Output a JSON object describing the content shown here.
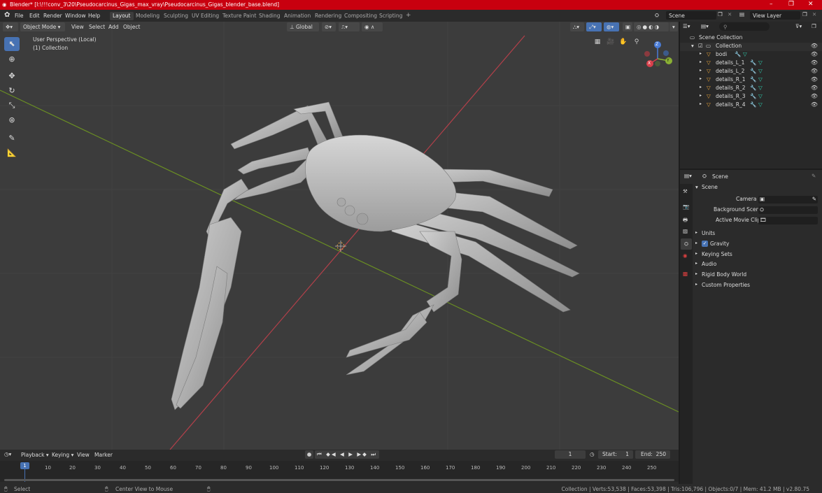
{
  "window": {
    "title": "Blender* [I:\\!!!conv_3\\20\\Pseudocarcinus_Gigas_max_vray\\Pseudocarcinus_Gigas_blender_base.blend]",
    "minimize": "–",
    "maximize": "❐",
    "close": "✕"
  },
  "menu": {
    "items": [
      "File",
      "Edit",
      "Render",
      "Window",
      "Help"
    ]
  },
  "workspaces": [
    "Layout",
    "Modeling",
    "Sculpting",
    "UV Editing",
    "Texture Paint",
    "Shading",
    "Animation",
    "Rendering",
    "Compositing",
    "Scripting",
    "+"
  ],
  "scene_name": "Scene",
  "view_layer": "View Layer",
  "viewport": {
    "mode": "Object Mode",
    "menus": [
      "View",
      "Select",
      "Add",
      "Object"
    ],
    "transform": "Global",
    "overlay_line1": "User Perspective (Local)",
    "overlay_line2": "(1) Collection",
    "gizmo": {
      "z": "Z",
      "y": "Y",
      "x": "X"
    }
  },
  "outliner": {
    "search_placeholder": "",
    "root": "Scene Collection",
    "collection": "Collection",
    "objects": [
      "bodi",
      "details_L_1",
      "details_L_2",
      "details_R_1",
      "details_R_2",
      "details_R_3",
      "details_R_4"
    ]
  },
  "properties": {
    "header": "Scene",
    "panel": "Scene",
    "fields": [
      {
        "label": "Camera",
        "value": ""
      },
      {
        "label": "Background Scene",
        "value": ""
      },
      {
        "label": "Active Movie Clip",
        "value": ""
      }
    ],
    "sections": [
      "Units",
      "Gravity",
      "Keying Sets",
      "Audio",
      "Rigid Body World",
      "Custom Properties"
    ],
    "gravity_checked": true
  },
  "timeline": {
    "menus": [
      "Playback",
      "Keying",
      "View",
      "Marker"
    ],
    "current_frame": "1",
    "start_label": "Start:",
    "start": "1",
    "end_label": "End:",
    "end": "250",
    "ticks": [
      "10",
      "20",
      "30",
      "40",
      "50",
      "60",
      "70",
      "80",
      "90",
      "100",
      "110",
      "120",
      "130",
      "140",
      "150",
      "160",
      "170",
      "180",
      "190",
      "200",
      "210",
      "220",
      "230",
      "240",
      "250"
    ],
    "playhead": "1"
  },
  "statusbar": {
    "left": "Select",
    "middle": "Center View to Mouse",
    "right": "Collection | Verts:53,538 | Faces:53,398 | Tris:106,796 | Objects:0/7 | Mem: 41.2 MB | v2.80.75"
  },
  "colors": {
    "accent": "#4772b3",
    "title_red": "#c8000f",
    "x_axis": "#b4404a",
    "y_axis": "#6a8e23"
  }
}
